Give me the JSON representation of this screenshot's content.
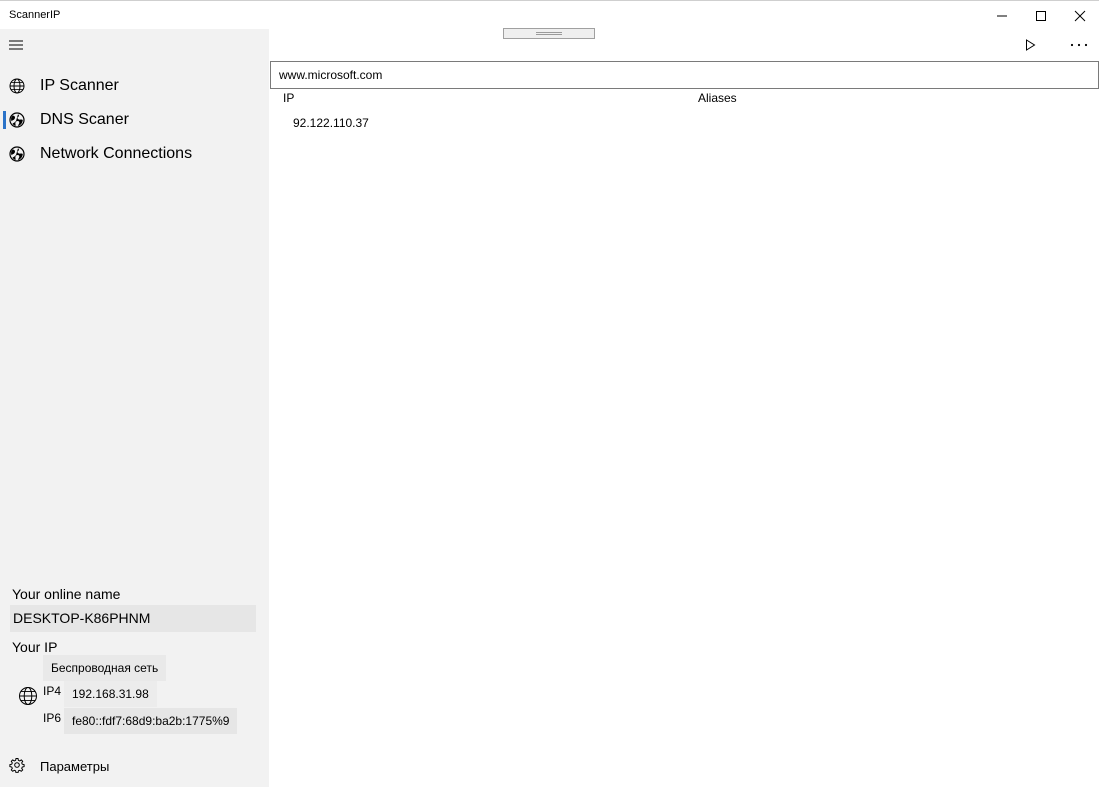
{
  "window": {
    "title": "ScannerIP"
  },
  "sidebar": {
    "items": [
      {
        "label": "IP Scanner",
        "icon": "globe-icon",
        "selected": false
      },
      {
        "label": "DNS Scaner",
        "icon": "globe-filled-icon",
        "selected": true
      },
      {
        "label": "Network Connections",
        "icon": "globe-filled-icon",
        "selected": false
      }
    ],
    "online_name_label": "Your online name",
    "online_name_value": "DESKTOP-K86PHNM",
    "your_ip_label": "Your IP",
    "adapter_name": "Беспроводная сеть",
    "ip4_label": "IP4",
    "ip4_value": "192.168.31.98",
    "ip6_label": "IP6",
    "ip6_value": "fe80::fdf7:68d9:ba2b:1775%9",
    "settings_label": "Параметры"
  },
  "main": {
    "search_value": "www.microsoft.com",
    "columns": [
      "IP",
      "Aliases"
    ],
    "rows": [
      {
        "ip": "92.122.110.37",
        "aliases": ""
      }
    ]
  },
  "colors": {
    "sidebar_bg": "#f2f2f2",
    "accent": "#2b73c9"
  }
}
